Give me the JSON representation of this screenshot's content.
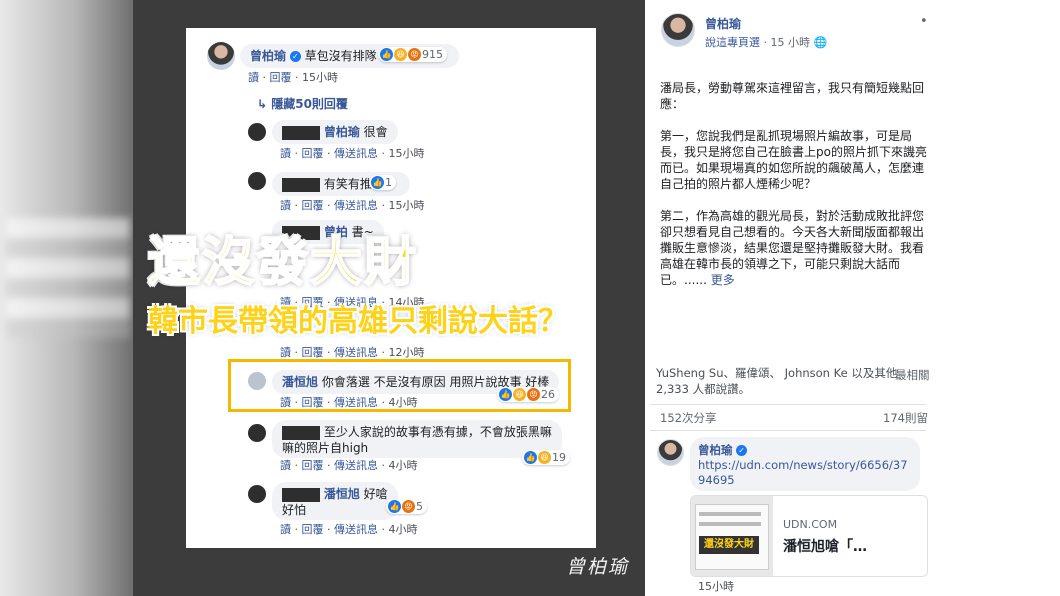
{
  "screenshot": {
    "main_comment": {
      "name": "曾柏瑜",
      "text": "草包沒有排隊",
      "reaction_count": "915",
      "meta": {
        "read": "讀",
        "reply": "回覆",
        "time": "15小時"
      }
    },
    "hide_replies": "隱藏50則回覆",
    "replies": [
      {
        "name": "曾柏瑜",
        "text": "很會",
        "meta": {
          "read": "讀",
          "reply": "回覆",
          "message": "傳送訊息",
          "time": "15小時"
        }
      },
      {
        "name": "",
        "text": "有笑有推",
        "reaction_count": "1",
        "meta": {
          "read": "讀",
          "reply": "回覆",
          "message": "傳送訊息",
          "time": "15小時"
        }
      },
      {
        "name": "曾柏",
        "text": "書~",
        "meta": {
          "read": "讀",
          "reply": "回覆",
          "message": "傳送訊息",
          "time": "14小時"
        }
      },
      {
        "name": "",
        "text": "",
        "meta": {
          "read": "讀",
          "reply": "回覆",
          "message": "傳送訊息",
          "time": "12小時"
        }
      },
      {
        "name": "潘恒旭",
        "text": "你會落選 不是沒有原因 用照片說故事 好棒",
        "reaction_count": "26",
        "meta": {
          "read": "讀",
          "reply": "回覆",
          "message": "傳送訊息",
          "time": "4小時"
        }
      },
      {
        "name": "",
        "text": "至少人家說的故事有憑有據，不會放張黑嘛",
        "text2": "嘛的照片自high",
        "reaction_count": "19",
        "meta": {
          "read": "讀",
          "reply": "回覆",
          "message": "傳送訊息",
          "time": "4小時"
        }
      },
      {
        "name": "潘恒旭",
        "text": "好嗆",
        "text2": "好怕",
        "reaction_count": "5",
        "meta": {
          "read": "讀",
          "reply": "回覆",
          "message": "傳送訊息",
          "time": "4小時"
        }
      }
    ]
  },
  "overlay": {
    "headline1": "還沒發大財",
    "headline2": "韓市長帶領的高雄只剩說大話？",
    "signature": "曾柏瑜"
  },
  "post": {
    "author": "曾柏瑜",
    "source_link": "說這專頁選",
    "time": "15 小時",
    "paragraphs": [
      "潘局長，勞動尊駕來這裡留言，我只有簡短幾點回應：",
      "第一，您說我們是亂抓現場照片編故事，可是局長，我只是將您自己在臉書上po的照片抓下來譏亮而已。如果現場真的如您所說的飆破萬人，怎麼連自己拍的照片都人煙稀少呢？",
      "第二，作為高雄的觀光局長，對於活動成敗批評您卻只想看見自己想看的。今天各大新聞版面都報出攤販生意慘淡，結果您還是堅持攤販發大財。我看高雄在韓市長的領導之下，可能只剩說大話而已。......"
    ],
    "more": "更多",
    "likes_line": "YuSheng Su、羅偉頌、 Johnson Ke 以及其他 2,333 人都說讚。",
    "most_relevant": "最相關",
    "shares": "152次分享",
    "comments": "174則留",
    "comment": {
      "author": "曾柏瑜",
      "url": "https://udn.com/news/story/6656/3794695",
      "preview_domain": "UDN.COM",
      "preview_title": "潘恒旭嗆「…",
      "preview_thumb_text": "還沒發大財",
      "time": "15小時"
    }
  }
}
